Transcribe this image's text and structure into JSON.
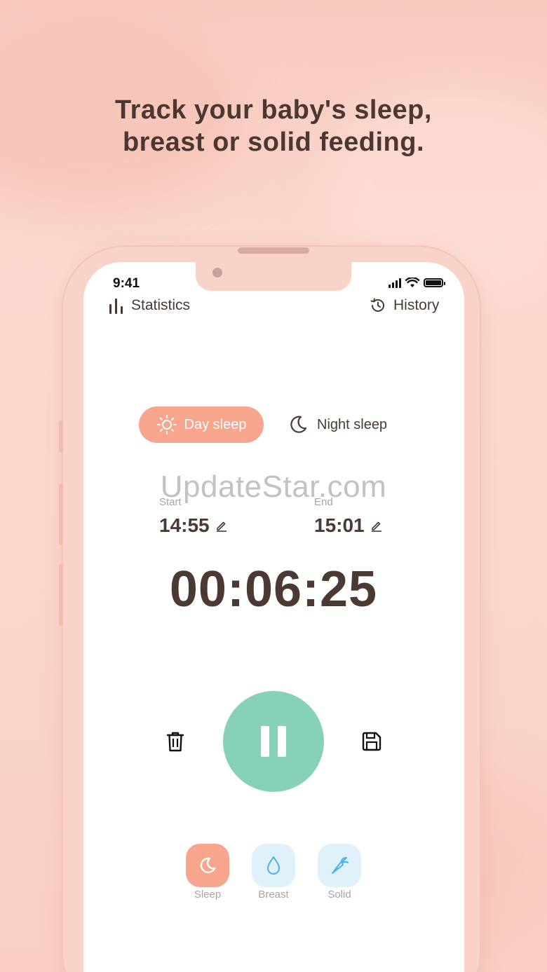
{
  "headline": {
    "line1": "Track your baby's sleep,",
    "line2": "breast or solid feeding."
  },
  "status_bar": {
    "time": "9:41"
  },
  "nav": {
    "statistics_label": "Statistics",
    "history_label": "History"
  },
  "sleep_toggle": {
    "day_label": "Day sleep",
    "night_label": "Night sleep",
    "selected": "Day sleep"
  },
  "watermark": "UpdateStar.com",
  "times": {
    "start_label": "Start",
    "start_value": "14:55",
    "end_label": "End",
    "end_value": "15:01"
  },
  "timer": {
    "elapsed": "00:06:25"
  },
  "modes": [
    {
      "label": "Sleep",
      "icon": "moon-icon",
      "active": true
    },
    {
      "label": "Breast",
      "icon": "drop-icon",
      "active": false
    },
    {
      "label": "Solid",
      "icon": "carrot-icon",
      "active": false
    }
  ],
  "colors": {
    "accent_orange": "#f7a58d",
    "accent_green": "#86d1b8",
    "tile_blue": "#dff1fb",
    "text_dark": "#4a3a36",
    "text_muted": "#a9a4a2"
  }
}
